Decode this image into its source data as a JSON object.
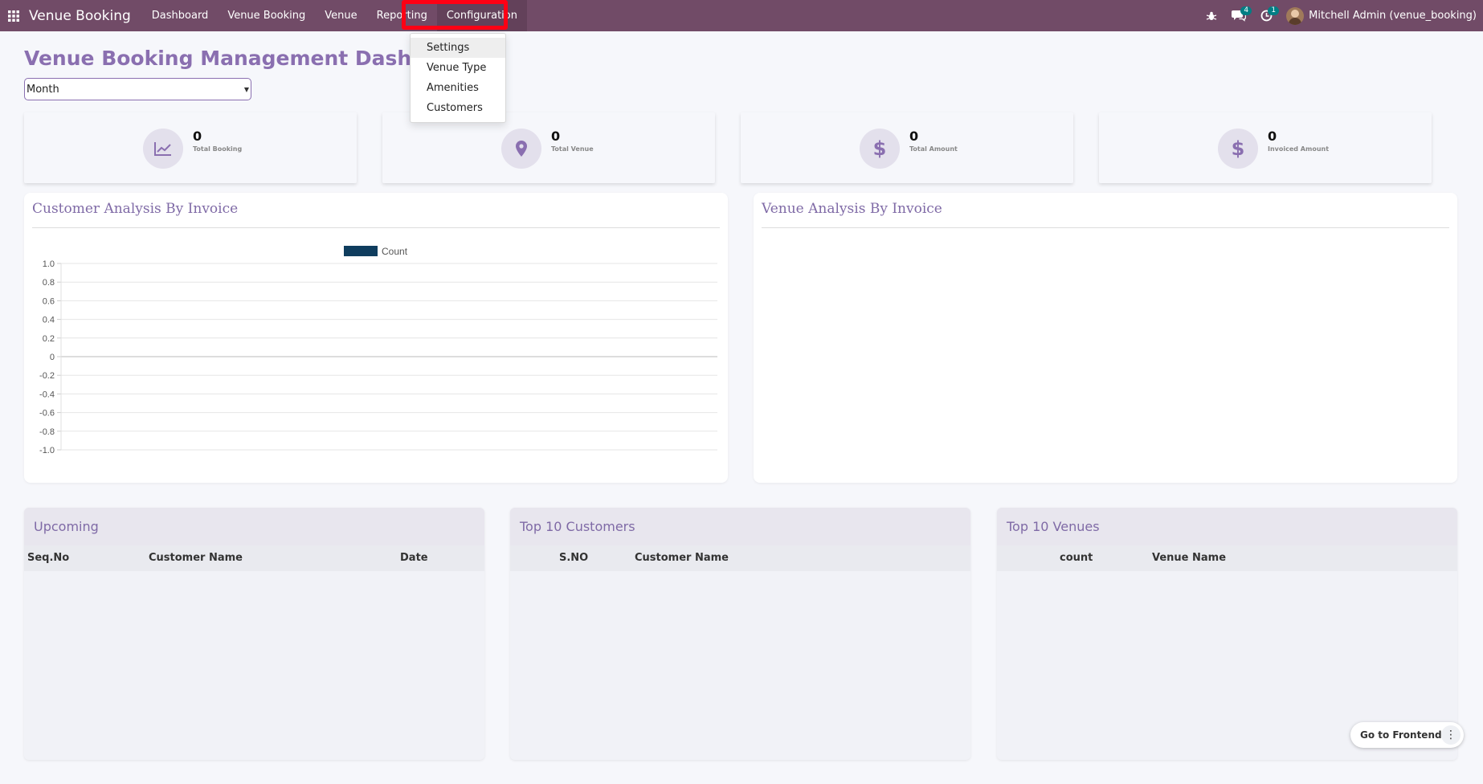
{
  "navbar": {
    "app_name": "Venue Booking",
    "menu": [
      "Dashboard",
      "Venue Booking",
      "Venue",
      "Reporting",
      "Configuration"
    ],
    "messages_count": "4",
    "activities_count": "1",
    "user": "Mitchell Admin (venue_booking)"
  },
  "configuration_menu": [
    "Settings",
    "Venue Type",
    "Amenities",
    "Customers"
  ],
  "dashboard": {
    "title": "Venue Booking Management Dashboard",
    "period": "Month",
    "kpis": [
      {
        "value": "0",
        "label": "Total Booking",
        "icon": "chart-line-icon"
      },
      {
        "value": "0",
        "label": "Total Venue",
        "icon": "map-marker-icon"
      },
      {
        "value": "0",
        "label": "Total Amount",
        "icon": "dollar-icon"
      },
      {
        "value": "0",
        "label": "Invoiced Amount",
        "icon": "dollar-icon"
      }
    ]
  },
  "customer_chart": {
    "title": "Customer Analysis By Invoice",
    "chart_data": {
      "type": "bar",
      "categories": [],
      "series": [
        {
          "name": "Count",
          "values": []
        }
      ],
      "ylim": [
        -1.0,
        1.0
      ],
      "yticks": [
        "1.0",
        "0.8",
        "0.6",
        "0.4",
        "0.2",
        "0",
        "-0.2",
        "-0.4",
        "-0.6",
        "-0.8",
        "-1.0"
      ],
      "legend": "top",
      "grid": true,
      "series_color": "#0f3d5e"
    }
  },
  "venue_chart": {
    "title": "Venue Analysis By Invoice"
  },
  "tables": {
    "upcoming": {
      "title": "Upcoming",
      "columns": [
        "Seq.No",
        "Customer Name",
        "Date"
      ]
    },
    "top_customers": {
      "title": "Top 10 Customers",
      "columns": [
        "S.NO",
        "Customer Name"
      ]
    },
    "top_venues": {
      "title": "Top 10 Venues",
      "columns": [
        "count",
        "Venue Name"
      ]
    }
  },
  "frontend_button": "Go to Frontend",
  "colors": {
    "navbar": "#714b67",
    "accent": "#8a6fb0",
    "highlight": "#ff0014",
    "badge": "#017e84"
  }
}
